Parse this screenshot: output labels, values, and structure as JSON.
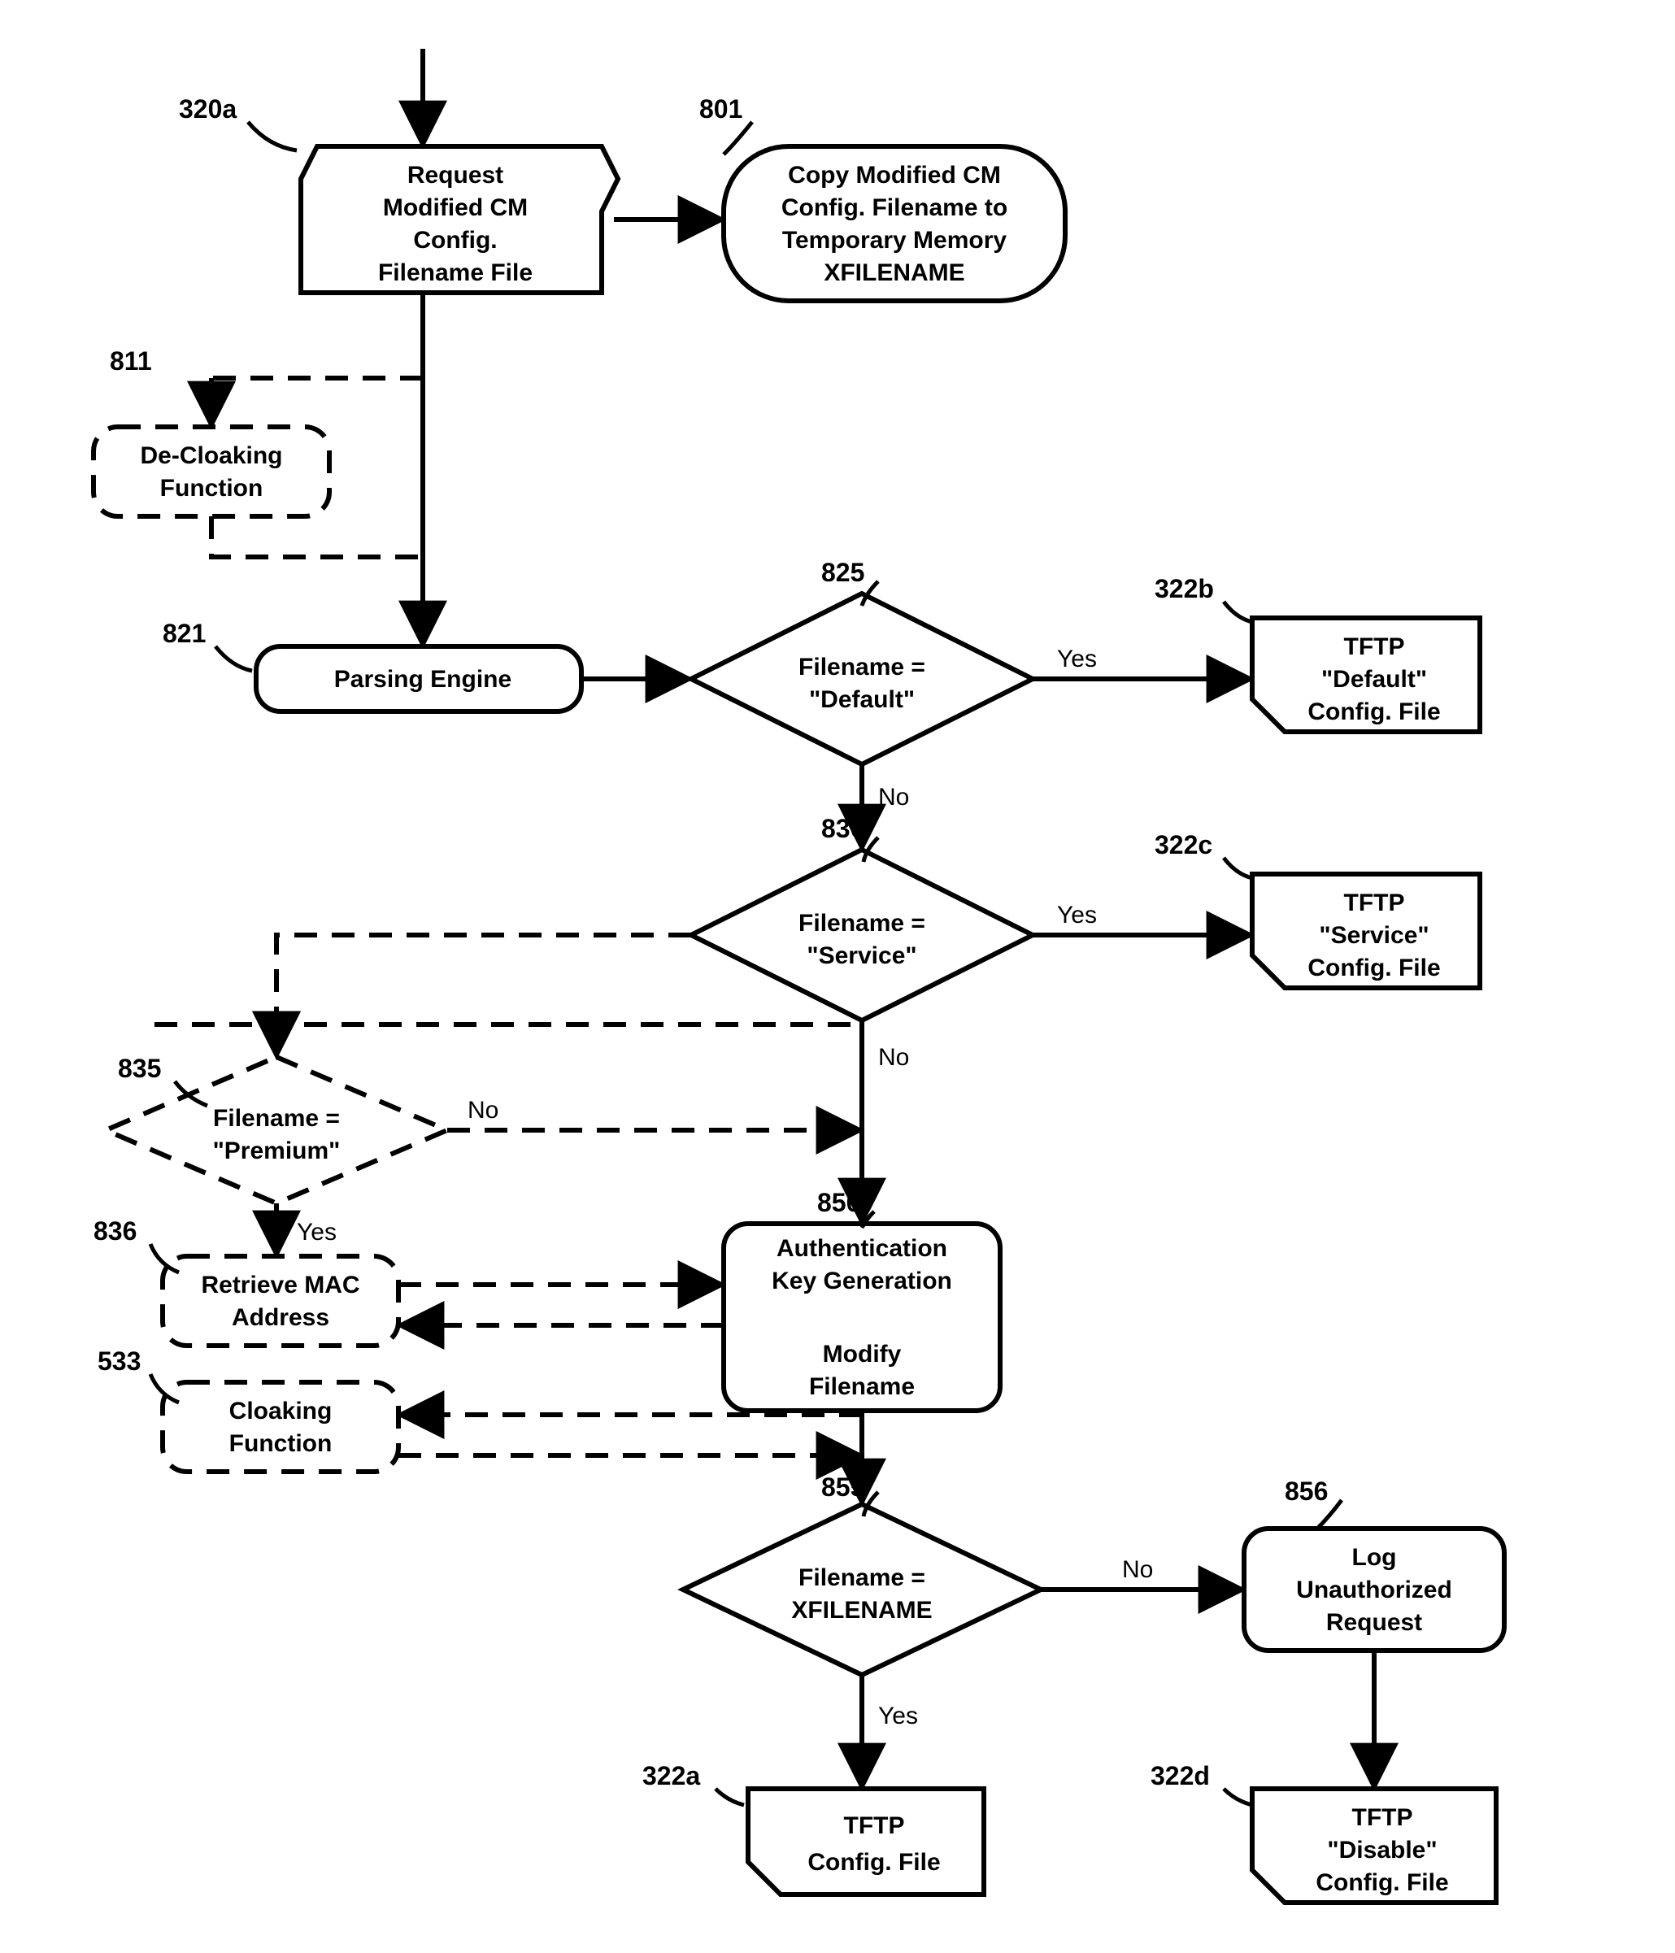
{
  "labels": {
    "l320a": "320a",
    "l801": "801",
    "l811": "811",
    "l821": "821",
    "l825": "825",
    "l322b": "322b",
    "l830": "830",
    "l322c": "322c",
    "l835": "835",
    "l836": "836",
    "l850": "850",
    "l533": "533",
    "l855": "855",
    "l856": "856",
    "l322a": "322a",
    "l322d": "322d"
  },
  "nodes": {
    "n320a": {
      "l1": "Request",
      "l2": "Modified  CM",
      "l3": "Config.",
      "l4": "Filename File"
    },
    "n801": {
      "l1": "Copy Modified CM",
      "l2": "Config. Filename to",
      "l3": "Temporary Memory",
      "l4": "XFILENAME"
    },
    "n811": {
      "l1": "De-Cloaking",
      "l2": "Function"
    },
    "n821": {
      "l1": "Parsing Engine"
    },
    "n825": {
      "l1": "Filename =",
      "l2": "\"Default\""
    },
    "n322b": {
      "l1": "TFTP",
      "l2": "\"Default\"",
      "l3": "Config. File"
    },
    "n830": {
      "l1": "Filename =",
      "l2": "\"Service\""
    },
    "n322c": {
      "l1": "TFTP",
      "l2": "\"Service\"",
      "l3": "Config. File"
    },
    "n835": {
      "l1": "Filename =",
      "l2": "\"Premium\""
    },
    "n836": {
      "l1": "Retrieve MAC",
      "l2": "Address"
    },
    "n850": {
      "l1": "Authentication",
      "l2": "Key  Generation",
      "l3": "Modify",
      "l4": "Filename"
    },
    "n533": {
      "l1": "Cloaking",
      "l2": "Function"
    },
    "n855": {
      "l1": "Filename =",
      "l2": "XFILENAME"
    },
    "n856": {
      "l1": "Log",
      "l2": "Unauthorized",
      "l3": "Request"
    },
    "n322a": {
      "l1": "TFTP",
      "l2": "Config. File"
    },
    "n322d": {
      "l1": "TFTP",
      "l2": "\"Disable\"",
      "l3": "Config. File"
    }
  },
  "edges": {
    "yes": "Yes",
    "no": "No"
  }
}
